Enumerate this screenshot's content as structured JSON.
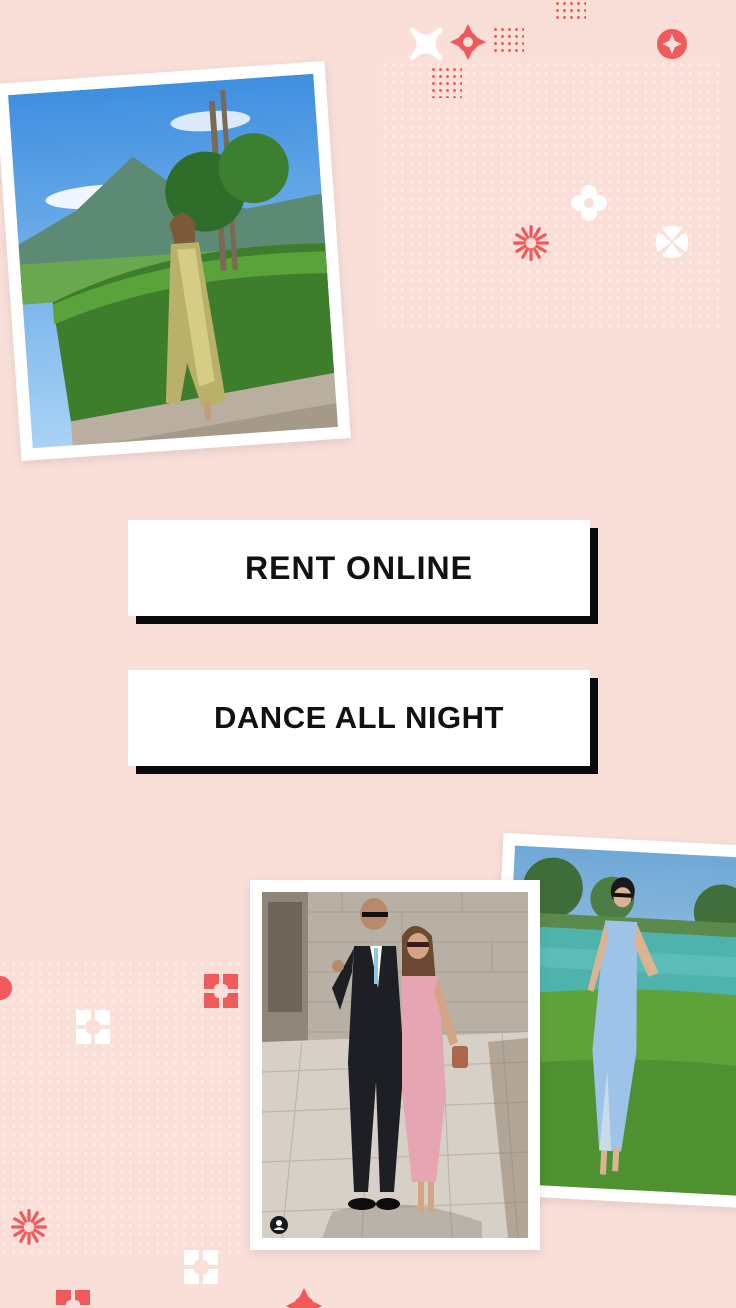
{
  "banners": {
    "line1": "RENT ONLINE",
    "line2": "DANCE ALL NIGHT"
  },
  "photos": [
    {
      "subject": "woman-in-gold-satin-gown-by-hedge"
    },
    {
      "subject": "couple-pink-dress-and-suit"
    },
    {
      "subject": "woman-in-blue-midi-dress-by-lake"
    }
  ],
  "icons": {
    "avatar": "user-icon"
  },
  "colors": {
    "background": "#fadfd9",
    "accent": "#f05a5a",
    "banner_shadow": "#0a0a0a"
  }
}
